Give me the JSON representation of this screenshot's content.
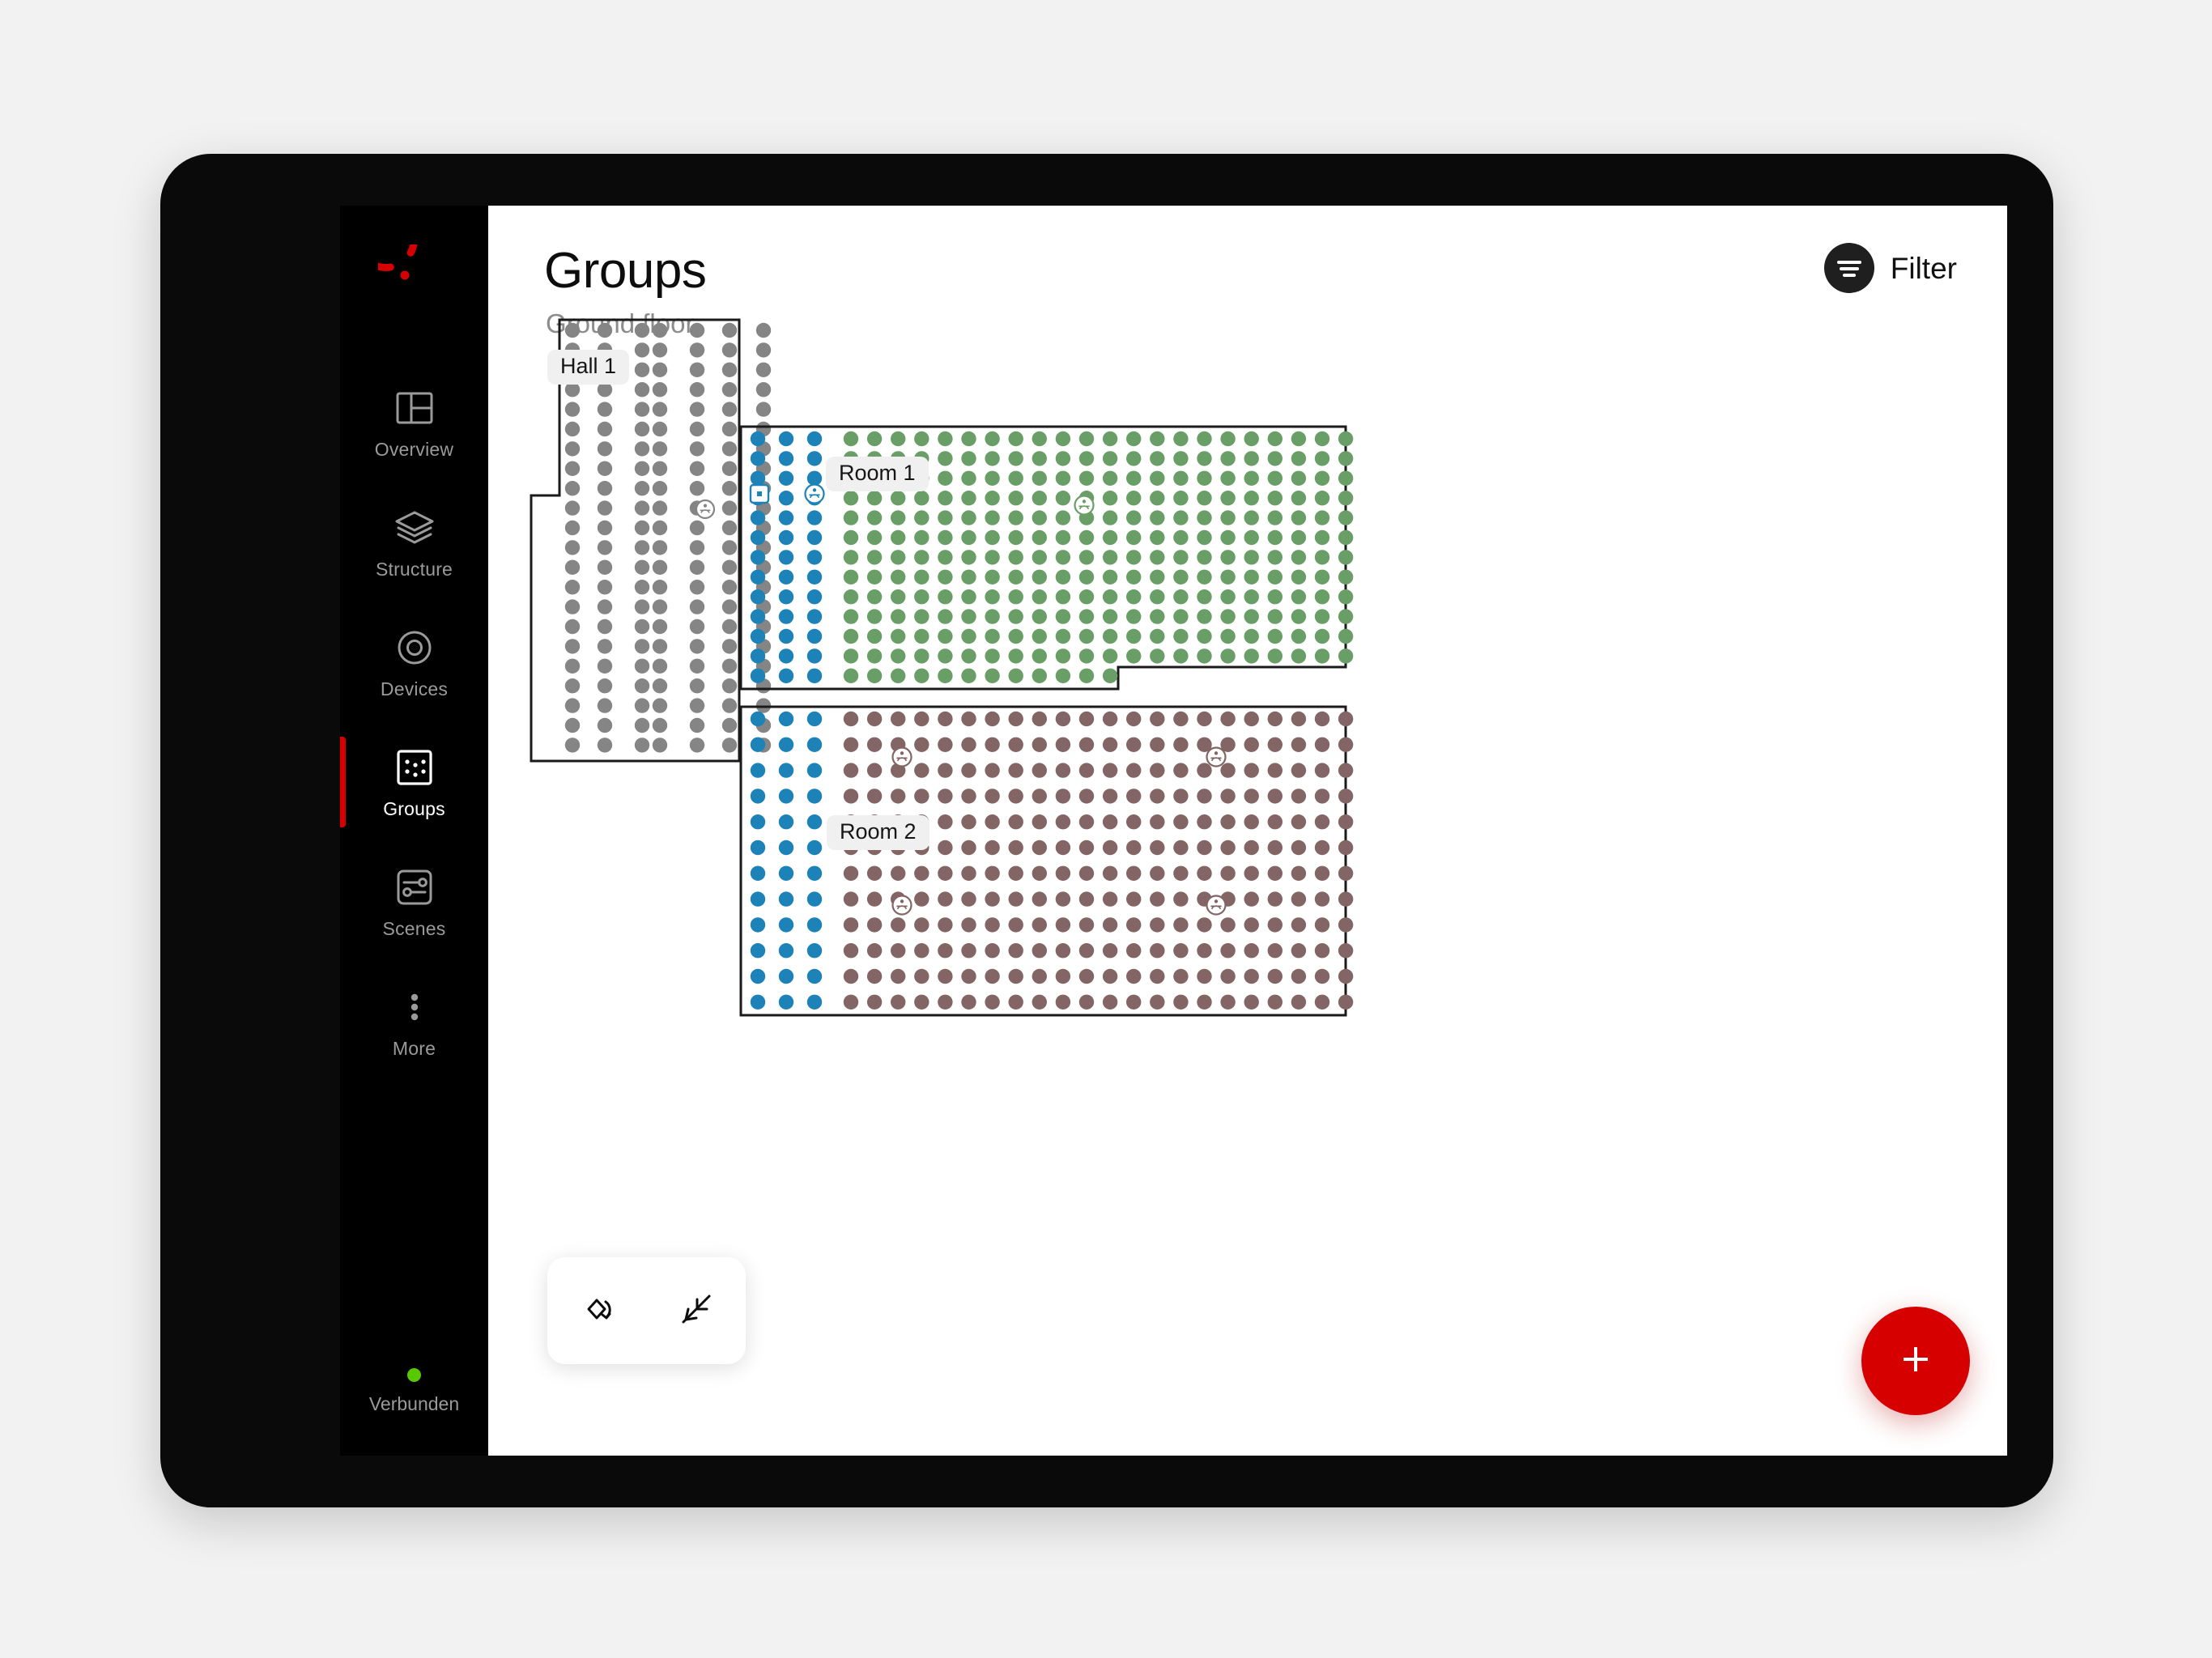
{
  "app": {
    "brand_logo_icon": "circular-arc-logo",
    "accent_color": "#d60000"
  },
  "sidebar": {
    "items": [
      {
        "label": "Overview",
        "icon": "layout-panel-icon",
        "active": false
      },
      {
        "label": "Structure",
        "icon": "layers-icon",
        "active": false
      },
      {
        "label": "Devices",
        "icon": "concentric-circle-icon",
        "active": false
      },
      {
        "label": "Groups",
        "icon": "dot-grid-square-icon",
        "active": true
      },
      {
        "label": "Scenes",
        "icon": "sliders-square-icon",
        "active": false
      },
      {
        "label": "More",
        "icon": "dots-vertical-icon",
        "active": false
      }
    ],
    "status": {
      "label": "Verbunden",
      "dot_icon": "status-dot-icon",
      "color": "#58c800"
    }
  },
  "header": {
    "title": "Groups",
    "subtitle": "Ground floor",
    "filter": {
      "label": "Filter",
      "icon": "filter-lines-icon"
    }
  },
  "floorplan": {
    "zones": [
      {
        "name": "Hall 1",
        "dot_color": "#858585",
        "marker_color": "#858585"
      },
      {
        "name": "Room 1",
        "dot_colors": [
          "#1c82b8",
          "#6a9e67"
        ],
        "marker_icons": [
          "sensor-square-icon",
          "lamp-circle-icon"
        ]
      },
      {
        "name": "Room 2",
        "dot_colors": [
          "#1c82b8",
          "#836565"
        ],
        "marker_icons": [
          "lamp-circle-icon"
        ]
      }
    ],
    "colors": {
      "grey": "#858585",
      "blue": "#1c82b8",
      "green": "#6a9e67",
      "brown": "#836565",
      "wall": "#1a1a1a"
    }
  },
  "view_toolbar": {
    "buttons": [
      {
        "name": "rotate-view-button",
        "icon": "rotate-diamond-icon"
      },
      {
        "name": "fit-to-screen-button",
        "icon": "collapse-arrows-icon"
      }
    ]
  },
  "fab": {
    "label": "+",
    "icon": "plus-icon",
    "color": "#d60000"
  }
}
